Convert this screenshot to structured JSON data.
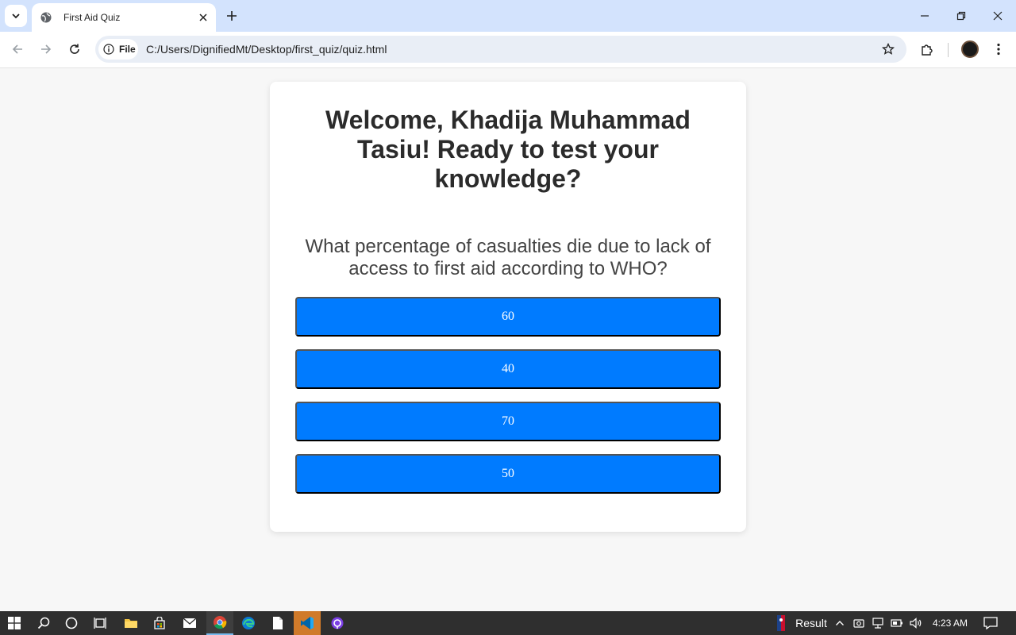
{
  "browser": {
    "tab_title": "First Aid Quiz",
    "file_chip_label": "File",
    "url": "C:/Users/DignifiedMt/Desktop/first_quiz/quiz.html"
  },
  "quiz": {
    "heading": "Welcome, Khadija Muhammad Tasiu! Ready to test your knowledge?",
    "question": "What percentage of casualties die due to lack of access to first aid according to WHO?",
    "answers": [
      "60",
      "40",
      "70",
      "50"
    ],
    "button_color": "#007bff"
  },
  "taskbar": {
    "tray_label": "Result",
    "clock": "4:23 AM"
  }
}
